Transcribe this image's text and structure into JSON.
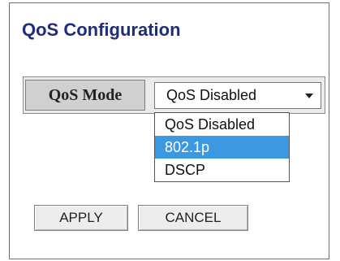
{
  "title": "QoS Configuration",
  "qos_mode": {
    "label": "QoS Mode",
    "selected": "QoS Disabled",
    "options": [
      "QoS Disabled",
      "802.1p",
      "DSCP"
    ],
    "highlighted_option": "802.1p"
  },
  "buttons": {
    "apply": "APPLY",
    "cancel": "CANCEL"
  },
  "colors": {
    "title": "#1f2d7a",
    "highlight": "#3c98e0"
  }
}
